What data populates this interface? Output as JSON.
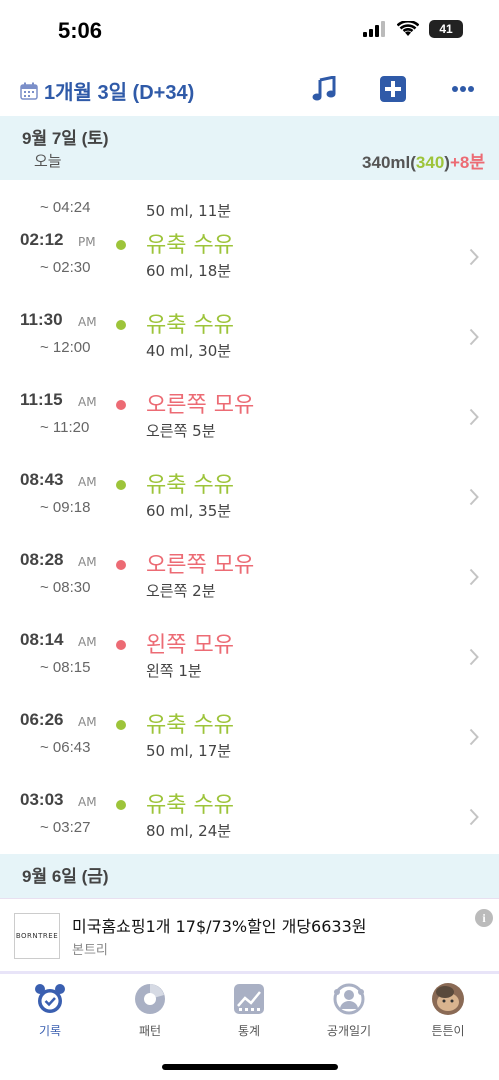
{
  "status_bar": {
    "time": "5:06",
    "battery": "41"
  },
  "header": {
    "title": "1개월 3일 (D+34)"
  },
  "day_today": {
    "date": "9월 7일 (토)",
    "sub": "오늘",
    "sum_total": "340ml",
    "sum_open": "(",
    "sum_green": "340",
    "sum_close": ")",
    "sum_red": "+8분"
  },
  "partial_row": {
    "end": "~ 04:24",
    "detail": "50 ml, 11분"
  },
  "rows": [
    {
      "start": "02:12",
      "ampm": "PM",
      "end": "~ 02:30",
      "type": "유축 수유",
      "detail": "60 ml, 18분",
      "color": "#9dc43a"
    },
    {
      "start": "11:30",
      "ampm": "AM",
      "end": "~ 12:00",
      "type": "유축 수유",
      "detail": "40 ml, 30분",
      "color": "#9dc43a"
    },
    {
      "start": "11:15",
      "ampm": "AM",
      "end": "~ 11:20",
      "type": "오른쪽 모유",
      "detail": "오른쪽 5분",
      "color": "#ec6b74"
    },
    {
      "start": "08:43",
      "ampm": "AM",
      "end": "~ 09:18",
      "type": "유축 수유",
      "detail": "60 ml, 35분",
      "color": "#9dc43a"
    },
    {
      "start": "08:28",
      "ampm": "AM",
      "end": "~ 08:30",
      "type": "오른쪽 모유",
      "detail": "오른쪽 2분",
      "color": "#ec6b74"
    },
    {
      "start": "08:14",
      "ampm": "AM",
      "end": "~ 08:15",
      "type": "왼쪽 모유",
      "detail": "왼쪽 1분",
      "color": "#ec6b74"
    },
    {
      "start": "06:26",
      "ampm": "AM",
      "end": "~ 06:43",
      "type": "유축 수유",
      "detail": "50 ml, 17분",
      "color": "#9dc43a"
    },
    {
      "start": "03:03",
      "ampm": "AM",
      "end": "~ 03:27",
      "type": "유축 수유",
      "detail": "80 ml, 24분",
      "color": "#9dc43a"
    }
  ],
  "day_prev": {
    "date": "9월 6일 (금)"
  },
  "ad": {
    "logo_text": "BORNTREE",
    "title": "미국홈쇼핑1개 17$/73%할인 개당6633원",
    "advertiser": "본트리"
  },
  "tabs": [
    {
      "label": "기록",
      "icon": "alarm-clock-icon"
    },
    {
      "label": "패턴",
      "icon": "pattern-chart-icon"
    },
    {
      "label": "통계",
      "icon": "stats-icon"
    },
    {
      "label": "공개일기",
      "icon": "public-diary-icon"
    },
    {
      "label": "튼튼이",
      "icon": "baby-avatar-icon"
    }
  ],
  "colors": {
    "accent": "#2f5aa8",
    "pump_green": "#9dc43a",
    "breast_red": "#ec6b74",
    "header_bg": "#e6f4f8",
    "tab_active": "#3a5fb0"
  }
}
